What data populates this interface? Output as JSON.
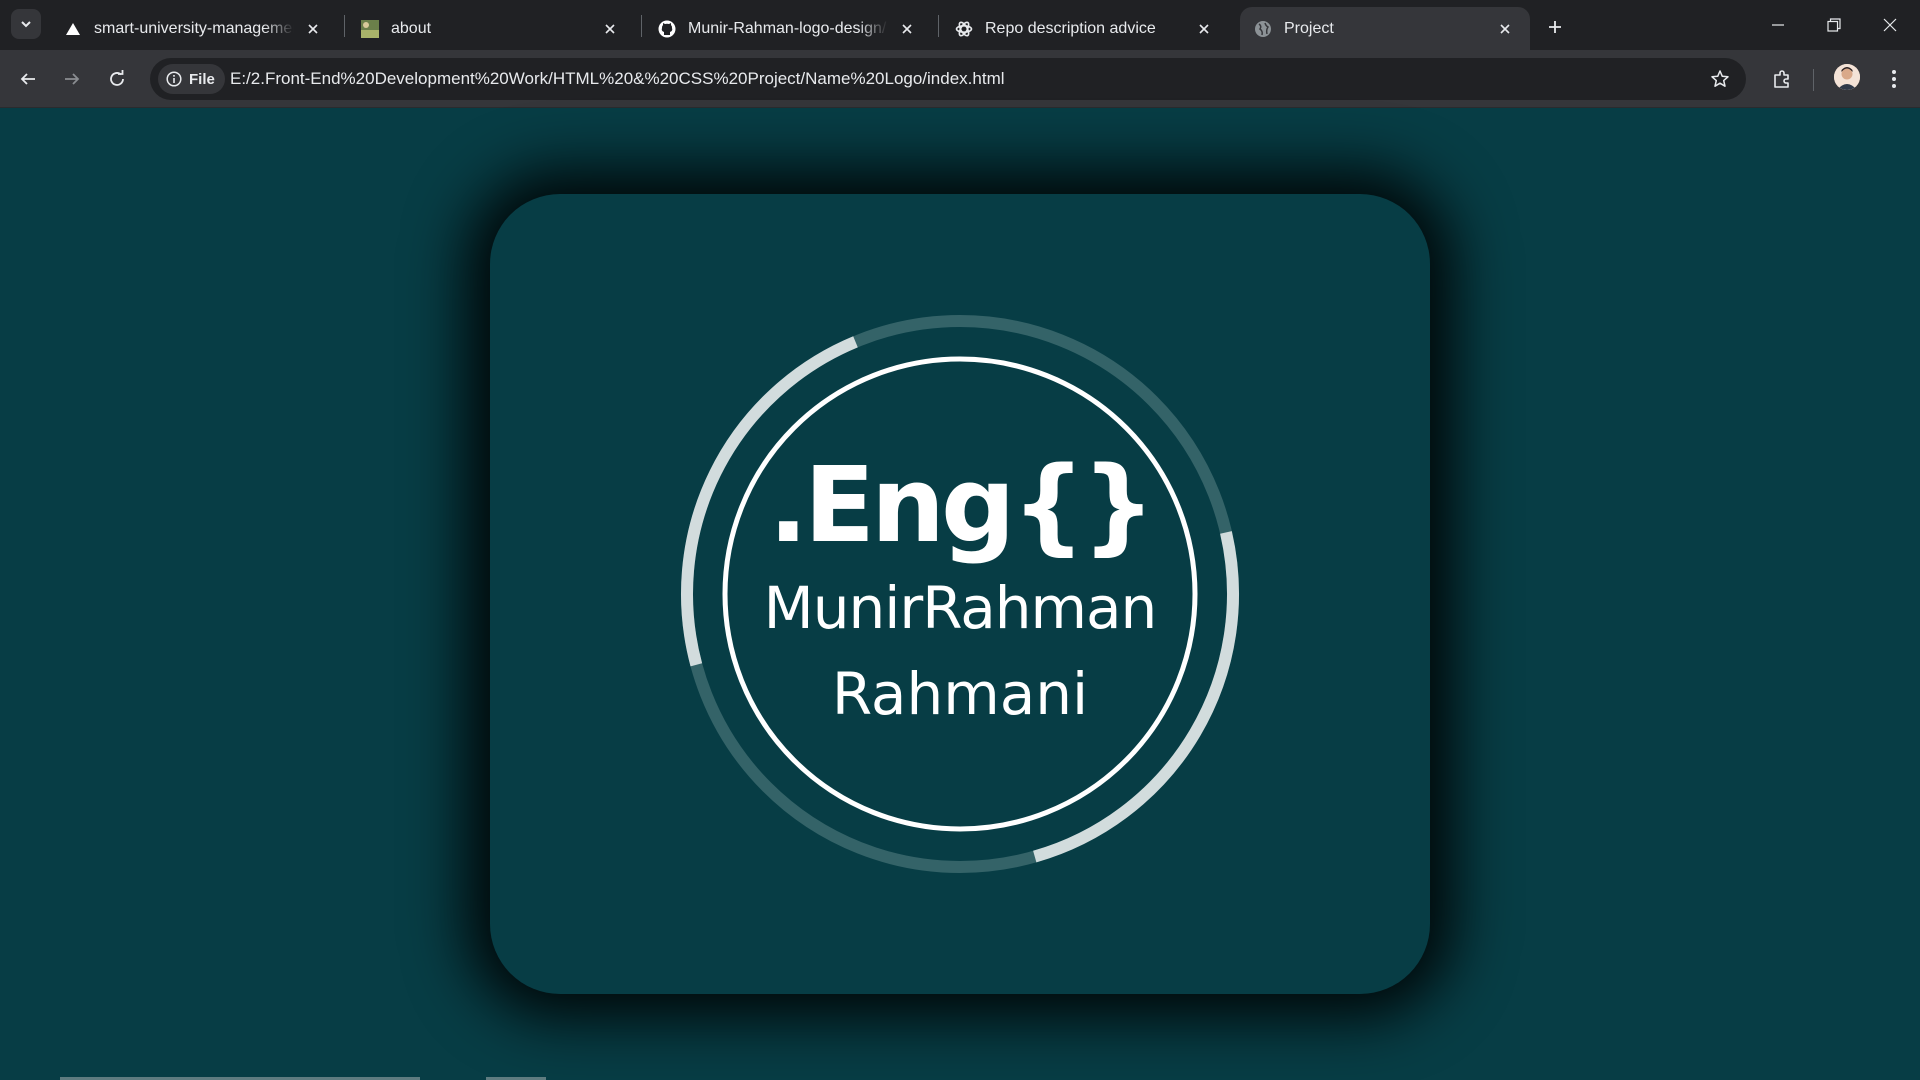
{
  "browser": {
    "tabs": [
      {
        "title": "smart-university-management-",
        "icon": "vercel-triangle-icon",
        "active": false
      },
      {
        "title": "about",
        "icon": "image-thumbnail-icon",
        "active": false
      },
      {
        "title": "Munir-Rahman-logo-design/RE",
        "icon": "github-icon",
        "active": false
      },
      {
        "title": "Repo description advice",
        "icon": "chatgpt-icon",
        "active": false
      },
      {
        "title": "Project",
        "icon": "globe-icon",
        "active": true
      }
    ],
    "site_chip": "File",
    "url": "E:/2.Front-End%20Development%20Work/HTML%20&%20CSS%20Project/Name%20Logo/index.html"
  },
  "logo": {
    "line1": ".Eng{}",
    "line2": "MunirRahman",
    "line3": "Rahmani"
  },
  "colors": {
    "page_bg": "#073d45",
    "ring_light": "#d2dcdd",
    "ring_dim": "#346368",
    "text": "#ffffff",
    "tabbar": "#202124",
    "toolbar": "#35363a"
  }
}
